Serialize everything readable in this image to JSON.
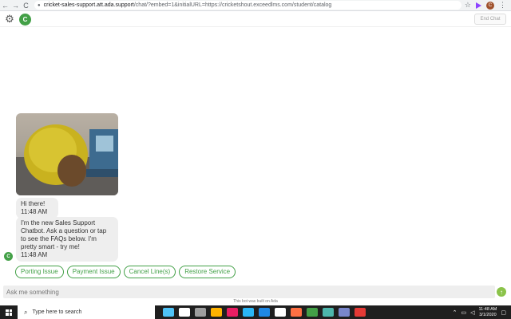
{
  "browser": {
    "back": "←",
    "forward": "→",
    "reload": "C",
    "url_host": "cricket-sales-support.att.ada.support",
    "url_rest": "/chat/?embed=1&initialURL=https://cricketshout.exceedlms.com/student/catalog",
    "profile_initial": "C"
  },
  "header": {
    "avatar_initial": "C",
    "end_chat_label": "End Chat"
  },
  "messages": [
    {
      "text": "Hi there!",
      "time": "11:48 AM"
    },
    {
      "text": "I'm the new Sales Support Chatbot. Ask a question or tap to see the FAQs below. I'm pretty smart - try me!",
      "time": "11:48 AM"
    }
  ],
  "bot_avatar_initial": "C",
  "quick_replies": [
    "Porting Issue",
    "Payment Issue",
    "Cancel Line(s)",
    "Restore Service"
  ],
  "input": {
    "placeholder": "Ask me something"
  },
  "footer": "This bot was built on Ada",
  "taskbar": {
    "search_placeholder": "Type here to search",
    "time": "11:48 AM",
    "date": "3/1/2020",
    "app_colors": [
      "#4fc3f7",
      "#ffffff",
      "#9e9e9e",
      "#ffb300",
      "#e91e63",
      "#29b6f6",
      "#1e88e5",
      "#ffffff",
      "#ff7043",
      "#43a047",
      "#4db6ac",
      "#7986cb",
      "#e53935"
    ]
  }
}
